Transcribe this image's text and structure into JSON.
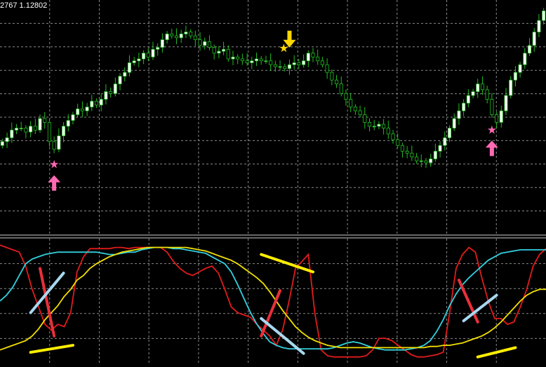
{
  "header": {
    "ohlc_text": "2767 1.12802"
  },
  "colors": {
    "background": "#000000",
    "grid": "#8a8a8a",
    "bull_candle": "#ffffff",
    "bear_candle": "#000000",
    "candle_outline": "#22bb22",
    "signal_buy": "#ff69b4",
    "signal_sell": "#ffd700",
    "osc_fast": "#e31b1b",
    "osc_mid": "#33d1e0",
    "osc_slow": "#f2e000",
    "div_red": "#e8303a",
    "div_blue": "#a8d8f0",
    "div_yellow": "#ffee00"
  },
  "chart_data": [
    {
      "type": "candlestick",
      "title": "",
      "xlabel": "",
      "ylabel": "",
      "ylim": [
        0,
        100
      ],
      "grid": true,
      "closes": [
        30,
        32,
        36,
        37,
        37,
        35,
        38,
        36,
        42,
        40,
        30,
        26,
        33,
        38,
        41,
        44,
        47,
        46,
        48,
        51,
        49,
        52,
        56,
        55,
        60,
        64,
        66,
        71,
        72,
        73,
        76,
        74,
        78,
        79,
        83,
        86,
        85,
        84,
        86,
        87,
        85,
        83,
        80,
        82,
        79,
        76,
        77,
        78,
        73,
        74,
        73,
        72,
        71,
        72,
        73,
        72,
        72,
        70,
        69,
        69,
        68,
        70,
        71,
        70,
        72,
        76,
        74,
        72,
        70,
        66,
        62,
        60,
        55,
        52,
        48,
        46,
        44,
        40,
        38,
        38,
        39,
        37,
        34,
        31,
        28,
        25,
        24,
        22,
        20,
        20,
        19,
        21,
        25,
        28,
        32,
        37,
        42,
        46,
        50,
        54,
        56,
        60,
        57,
        52,
        44,
        40,
        46,
        54,
        62,
        66,
        70,
        76,
        80,
        87,
        93,
        98
      ]
    },
    {
      "type": "line",
      "title": "",
      "xlabel": "",
      "ylabel": "",
      "ylim": [
        0,
        100
      ],
      "grid": true,
      "series": [
        {
          "values": [
            98,
            96,
            94,
            92,
            80,
            60,
            45,
            30,
            25,
            30,
            28,
            40,
            75,
            88,
            95,
            95,
            95,
            95,
            96,
            96,
            95,
            96,
            96,
            96,
            96,
            96,
            92,
            84,
            78,
            74,
            72,
            75,
            78,
            80,
            74,
            60,
            45,
            40,
            38,
            36,
            30,
            25,
            20,
            12,
            25,
            50,
            78,
            84,
            90,
            40,
            8,
            3,
            2,
            2,
            2,
            2,
            2,
            3,
            8,
            18,
            18,
            16,
            12,
            8,
            4,
            2,
            2,
            3,
            4,
            6,
            40,
            78,
            90,
            96,
            92,
            70,
            50,
            35,
            35,
            30,
            32,
            45,
            60,
            80,
            90,
            95
          ]
        },
        {
          "values": [
            50,
            55,
            62,
            72,
            82,
            86,
            88,
            90,
            91,
            92,
            92,
            92,
            92,
            92,
            92,
            92,
            91,
            90,
            90,
            91,
            92,
            92,
            94,
            95,
            96,
            96,
            96,
            95,
            95,
            94,
            93,
            92,
            91,
            88,
            85,
            82,
            75,
            64,
            52,
            40,
            30,
            22,
            15,
            12,
            10,
            9,
            9,
            9,
            9,
            9,
            9,
            9,
            10,
            12,
            14,
            15,
            14,
            12,
            10,
            9,
            8,
            8,
            8,
            8,
            9,
            10,
            12,
            16,
            24,
            34,
            46,
            56,
            64,
            70,
            75,
            80,
            85,
            88,
            91,
            92,
            93,
            94,
            94,
            94,
            94,
            94
          ]
        },
        {
          "values": [
            8,
            10,
            12,
            14,
            16,
            20,
            26,
            34,
            40,
            46,
            54,
            60,
            68,
            72,
            78,
            82,
            85,
            88,
            90,
            92,
            93,
            94,
            95,
            96,
            96,
            96,
            96,
            96,
            96,
            96,
            95,
            94,
            93,
            91,
            89,
            87,
            85,
            82,
            78,
            74,
            70,
            65,
            58,
            50,
            42,
            35,
            28,
            23,
            19,
            16,
            14,
            12,
            11,
            10,
            10,
            10,
            10,
            10,
            10,
            10,
            10,
            10,
            10,
            10,
            10,
            10,
            10,
            11,
            11,
            12,
            12,
            13,
            14,
            16,
            18,
            20,
            23,
            27,
            32,
            38,
            44,
            50,
            55,
            58,
            60,
            60
          ]
        }
      ]
    }
  ],
  "signals": [
    {
      "type": "buy",
      "bar": 11
    },
    {
      "type": "sell",
      "bar": 61
    },
    {
      "type": "buy",
      "bar": 104
    }
  ],
  "divergence_marks": [
    {
      "color": "div_red",
      "from": [
        8,
        78
      ],
      "to": [
        11,
        20
      ]
    },
    {
      "color": "div_blue",
      "from": [
        6,
        40
      ],
      "to": [
        13,
        74
      ]
    },
    {
      "color": "div_yellow",
      "from": [
        6,
        6
      ],
      "to": [
        15,
        12
      ]
    },
    {
      "color": "div_yellow",
      "from": [
        55,
        90
      ],
      "to": [
        66,
        75
      ]
    },
    {
      "color": "div_red",
      "from": [
        59,
        59
      ],
      "to": [
        55,
        20
      ]
    },
    {
      "color": "div_blue",
      "from": [
        55,
        35
      ],
      "to": [
        64,
        5
      ]
    },
    {
      "color": "div_red",
      "from": [
        97,
        68
      ],
      "to": [
        101,
        32
      ]
    },
    {
      "color": "div_blue",
      "from": [
        98,
        33
      ],
      "to": [
        105,
        55
      ]
    },
    {
      "color": "div_yellow",
      "from": [
        101,
        2
      ],
      "to": [
        109,
        10
      ]
    }
  ]
}
